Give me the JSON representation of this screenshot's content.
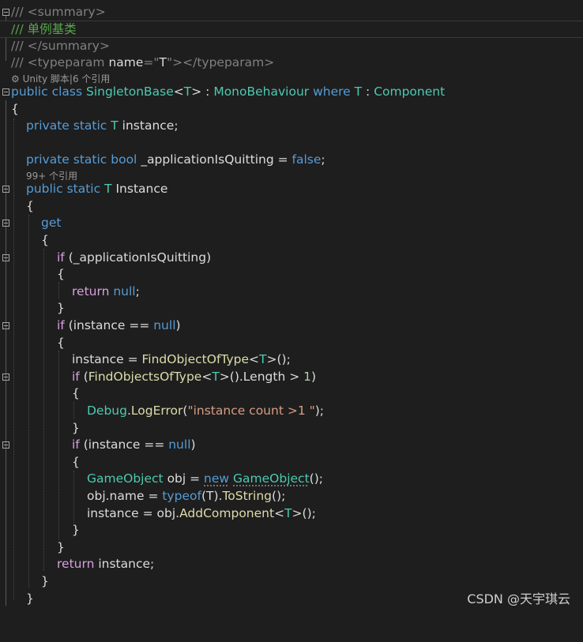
{
  "lines": {
    "l1": "/// <summary>",
    "l2": "/// 单例基类",
    "l3": "/// </summary>",
    "l4_a": "/// <typeparam ",
    "l4_b": "name",
    "l4_c": "=\"",
    "l4_d": "T",
    "l4_e": "\"></typeparam>",
    "lens1": "Unity 脚本|6 个引用",
    "l5": {
      "k1": "public",
      "k2": "class",
      "cls": "SingletonBase",
      "lt": "<",
      "t": "T",
      "gt": ">",
      "colon": " : ",
      "base": "MonoBehaviour",
      "where": "where",
      "t2": "T",
      "colon2": " : ",
      "comp": "Component"
    },
    "brace_open": "{",
    "l6": {
      "k1": "private",
      "k2": "static",
      "t": "T",
      "name": "instance;"
    },
    "l7": {
      "k1": "private",
      "k2": "static",
      "k3": "bool",
      "name": "_applicationIsQuitting",
      "eq": " = ",
      "val": "false",
      "semi": ";"
    },
    "lens2": "99+ 个引用",
    "l8": {
      "k1": "public",
      "k2": "static",
      "t": "T",
      "name": "Instance"
    },
    "l9": "{",
    "l10": "get",
    "l11": "{",
    "l12": {
      "kw": "if",
      "rest": " (_applicationIsQuitting)"
    },
    "l13": "{",
    "l14": {
      "kw": "return",
      "val": "null",
      "semi": ";"
    },
    "l15": "}",
    "l16": {
      "kw": "if",
      "rest": " (instance == ",
      "val": "null",
      "close": ")"
    },
    "l17": "{",
    "l18": {
      "a": "instance = ",
      "m": "FindObjectOfType",
      "lt": "<",
      "t": "T",
      "gt": ">();"
    },
    "l19": {
      "kw": "if",
      "a": " (",
      "m": "FindObjectsOfType",
      "lt": "<",
      "t": "T",
      "gt": ">().Length > ",
      "num": "1",
      "close": ")"
    },
    "l20": "{",
    "l21": {
      "cls": "Debug",
      "dot": ".",
      "m": "LogError",
      "a": "(",
      "s": "\"instance count >1 \"",
      "b": ");"
    },
    "l22": "}",
    "l23": {
      "kw": "if",
      "rest": " (instance == ",
      "val": "null",
      "close": ")"
    },
    "l24": "{",
    "l25": {
      "cls": "GameObject",
      "a": " obj = ",
      "kw": "new",
      "cls2": "GameObject",
      "b": "();"
    },
    "l26": {
      "a": "obj.name = ",
      "kw": "typeof",
      "b": "(T).",
      "m": "ToString",
      "c": "();"
    },
    "l27": {
      "a": "instance = obj.",
      "m": "AddComponent",
      "lt": "<",
      "t": "T",
      "gt": ">();"
    },
    "l28": "}",
    "l29": "}",
    "l30": {
      "kw": "return",
      "rest": " instance;"
    },
    "l31": "}",
    "l32": "}"
  },
  "watermark": "CSDN @天宇琪云",
  "colors": {
    "background": "#1e1e1e",
    "comment": "#57a64a",
    "keyword": "#569cd6",
    "control": "#d8a0df",
    "type": "#4ec9b0",
    "method": "#dcdcaa",
    "string": "#d69d85"
  }
}
